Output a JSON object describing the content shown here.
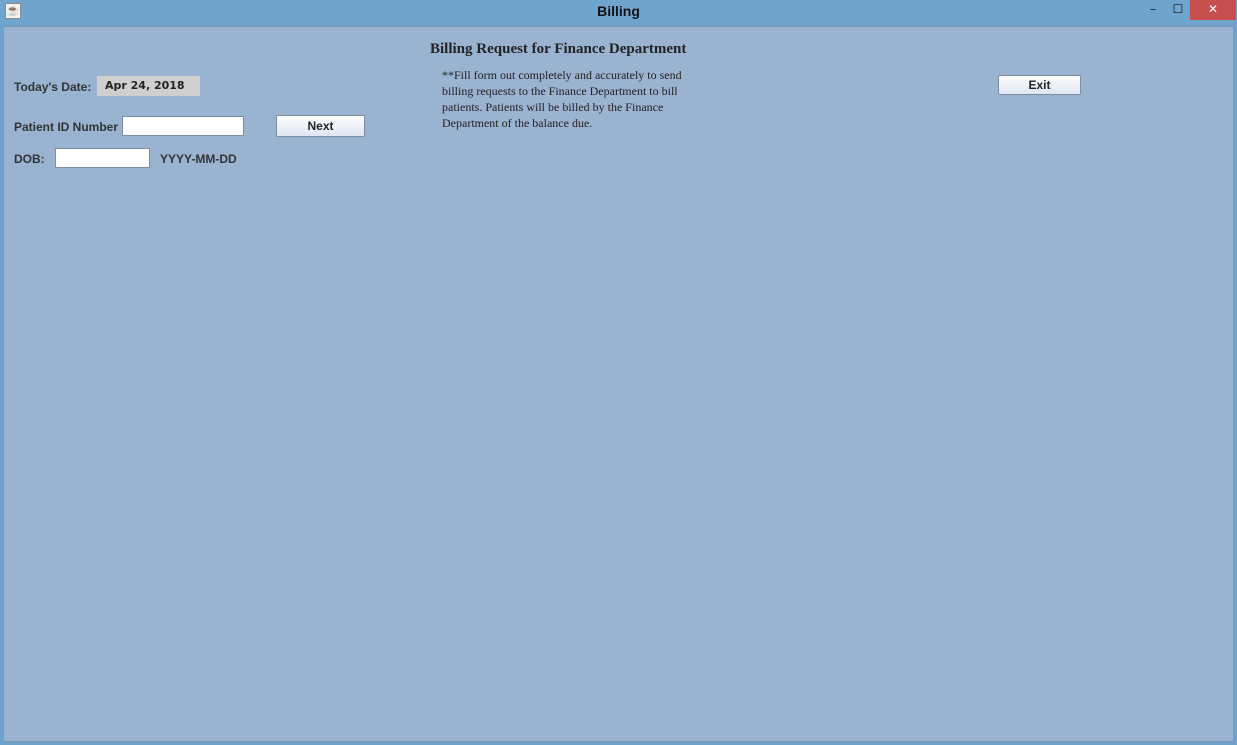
{
  "window": {
    "title": "Billing",
    "controls": {
      "minimize": "–",
      "maximize": "☐",
      "close": "✕"
    }
  },
  "form": {
    "heading": "Billing Request for Finance Department",
    "instructions": "**Fill form out completely and accurately to send billing requests to the Finance Department to bill patients. Patients will be billed by the Finance Department of the balance due.",
    "todays_date_label": "Today's Date:",
    "todays_date_value": "Apr 24, 2018",
    "patient_id_label": "Patient ID Number",
    "patient_id_value": "",
    "dob_label": "DOB:",
    "dob_value": "",
    "dob_format_hint": "YYYY-MM-DD",
    "next_button": "Next",
    "exit_button": "Exit"
  },
  "icons": [
    "java-app-icon",
    "minimize-icon",
    "maximize-icon",
    "close-icon"
  ]
}
